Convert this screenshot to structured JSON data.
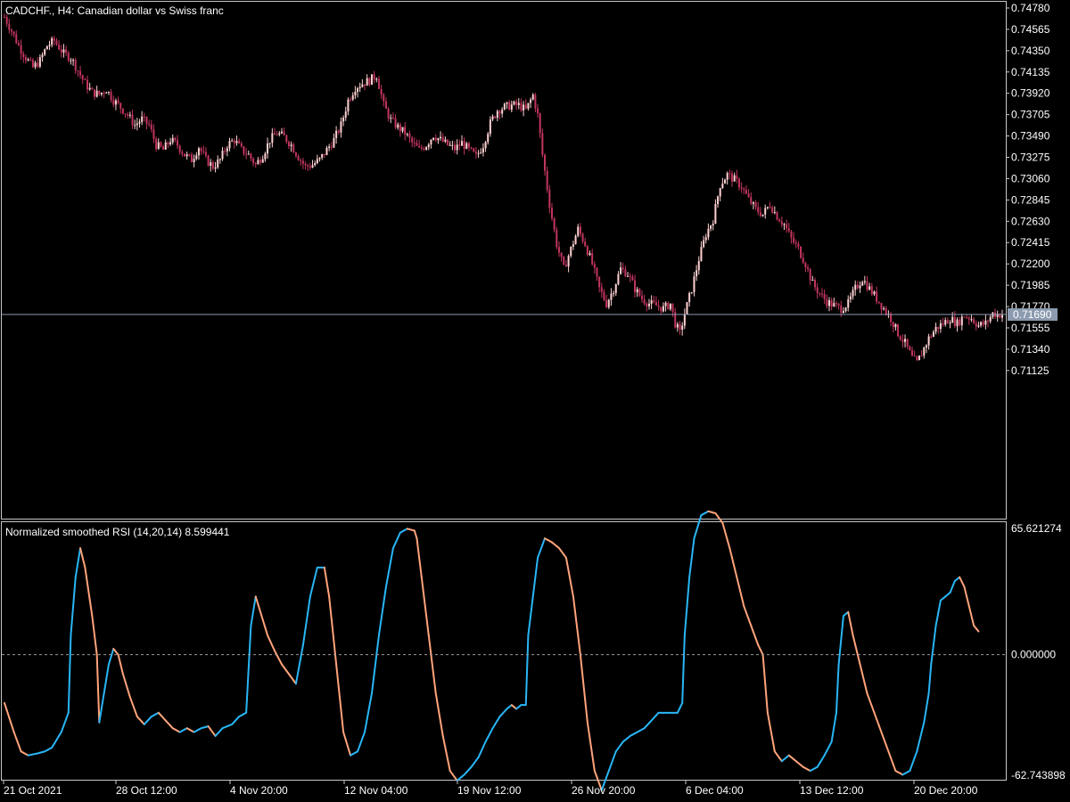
{
  "colors": {
    "background": "#000000",
    "frame": "#c8c8c8",
    "text": "#ffffff",
    "bull_candle": "#ffd1d1",
    "bear_candle": "#c2355e",
    "rsi_up": "#29b6f6",
    "rsi_down": "#ffa37a",
    "price_line": "#8c9bb0",
    "price_badge": "#8c9bb0"
  },
  "chart_data": {
    "type": "candlestick",
    "symbol_header": "CADCHF., H4:  Canadian dollar vs Swiss franc",
    "price_axis_ticks": [
      "0.74780",
      "0.74565",
      "0.74350",
      "0.74135",
      "0.73920",
      "0.73705",
      "0.73490",
      "0.73275",
      "0.73060",
      "0.72845",
      "0.72630",
      "0.72415",
      "0.72200",
      "0.71985",
      "0.71770",
      "0.71555",
      "0.71340",
      "0.71125"
    ],
    "price_range": [
      0.71,
      0.748
    ],
    "current_price": "0.71690",
    "time_axis_labels": [
      "21 Oct 2021",
      "28 Oct 12:00",
      "4 Nov 20:00",
      "12 Nov 04:00",
      "19 Nov 12:00",
      "26 Nov 20:00",
      "6 Dec 04:00",
      "13 Dec 12:00",
      "20 Dec 20:00"
    ],
    "price_anchors": [
      [
        0,
        0.7469
      ],
      [
        3,
        0.7455
      ],
      [
        6,
        0.744
      ],
      [
        9,
        0.7428
      ],
      [
        12,
        0.7418
      ],
      [
        15,
        0.7425
      ],
      [
        18,
        0.744
      ],
      [
        21,
        0.7445
      ],
      [
        25,
        0.7432
      ],
      [
        28,
        0.7428
      ],
      [
        31,
        0.7415
      ],
      [
        34,
        0.7402
      ],
      [
        37,
        0.7393
      ],
      [
        40,
        0.7391
      ],
      [
        43,
        0.7396
      ],
      [
        46,
        0.7385
      ],
      [
        49,
        0.7378
      ],
      [
        52,
        0.737
      ],
      [
        55,
        0.736
      ],
      [
        58,
        0.7366
      ],
      [
        61,
        0.736
      ],
      [
        64,
        0.734
      ],
      [
        67,
        0.7335
      ],
      [
        70,
        0.7345
      ],
      [
        73,
        0.734
      ],
      [
        76,
        0.733
      ],
      [
        79,
        0.7325
      ],
      [
        82,
        0.7338
      ],
      [
        85,
        0.7325
      ],
      [
        88,
        0.7318
      ],
      [
        91,
        0.7325
      ],
      [
        94,
        0.734
      ],
      [
        97,
        0.7345
      ],
      [
        100,
        0.7335
      ],
      [
        103,
        0.733
      ],
      [
        106,
        0.732
      ],
      [
        109,
        0.733
      ],
      [
        112,
        0.7345
      ],
      [
        115,
        0.7352
      ],
      [
        118,
        0.7348
      ],
      [
        121,
        0.734
      ],
      [
        124,
        0.7328
      ],
      [
        127,
        0.7318
      ],
      [
        130,
        0.732
      ],
      [
        133,
        0.7325
      ],
      [
        136,
        0.7335
      ],
      [
        139,
        0.7345
      ],
      [
        142,
        0.736
      ],
      [
        145,
        0.7385
      ],
      [
        148,
        0.7398
      ],
      [
        151,
        0.7402
      ],
      [
        154,
        0.7405
      ],
      [
        157,
        0.741
      ],
      [
        160,
        0.738
      ],
      [
        163,
        0.7365
      ],
      [
        166,
        0.7358
      ],
      [
        169,
        0.7352
      ],
      [
        172,
        0.7342
      ],
      [
        175,
        0.7335
      ],
      [
        178,
        0.734
      ],
      [
        181,
        0.735
      ],
      [
        184,
        0.7345
      ],
      [
        187,
        0.734
      ],
      [
        190,
        0.7336
      ],
      [
        193,
        0.7342
      ],
      [
        196,
        0.7335
      ],
      [
        199,
        0.7328
      ],
      [
        202,
        0.734
      ],
      [
        205,
        0.7362
      ],
      [
        208,
        0.7375
      ],
      [
        211,
        0.7378
      ],
      [
        214,
        0.738
      ],
      [
        217,
        0.738
      ],
      [
        220,
        0.7375
      ],
      [
        223,
        0.739
      ],
      [
        225,
        0.737
      ],
      [
        227,
        0.733
      ],
      [
        230,
        0.728
      ],
      [
        233,
        0.724
      ],
      [
        236,
        0.7215
      ],
      [
        239,
        0.7235
      ],
      [
        242,
        0.7255
      ],
      [
        245,
        0.724
      ],
      [
        248,
        0.722
      ],
      [
        251,
        0.7195
      ],
      [
        254,
        0.718
      ],
      [
        257,
        0.7195
      ],
      [
        260,
        0.7215
      ],
      [
        263,
        0.721
      ],
      [
        266,
        0.7195
      ],
      [
        269,
        0.7185
      ],
      [
        272,
        0.718
      ],
      [
        275,
        0.7178
      ],
      [
        278,
        0.7175
      ],
      [
        281,
        0.718
      ],
      [
        283,
        0.716
      ],
      [
        285,
        0.715
      ],
      [
        287,
        0.717
      ],
      [
        290,
        0.7195
      ],
      [
        293,
        0.7225
      ],
      [
        296,
        0.725
      ],
      [
        299,
        0.7265
      ],
      [
        302,
        0.73
      ],
      [
        305,
        0.731
      ],
      [
        308,
        0.7305
      ],
      [
        311,
        0.7298
      ],
      [
        314,
        0.7285
      ],
      [
        317,
        0.7275
      ],
      [
        320,
        0.727
      ],
      [
        323,
        0.728
      ],
      [
        326,
        0.7268
      ],
      [
        329,
        0.726
      ],
      [
        332,
        0.7245
      ],
      [
        335,
        0.7235
      ],
      [
        338,
        0.722
      ],
      [
        341,
        0.72
      ],
      [
        344,
        0.719
      ],
      [
        347,
        0.7182
      ],
      [
        350,
        0.7178
      ],
      [
        353,
        0.7175
      ],
      [
        356,
        0.718
      ],
      [
        359,
        0.7195
      ],
      [
        362,
        0.7205
      ],
      [
        365,
        0.7195
      ],
      [
        368,
        0.7185
      ],
      [
        371,
        0.7175
      ],
      [
        374,
        0.7165
      ],
      [
        377,
        0.715
      ],
      [
        380,
        0.714
      ],
      [
        383,
        0.7125
      ],
      [
        385,
        0.712
      ],
      [
        387,
        0.713
      ],
      [
        390,
        0.7145
      ],
      [
        393,
        0.7155
      ],
      [
        396,
        0.716
      ],
      [
        399,
        0.7165
      ],
      [
        402,
        0.716
      ],
      [
        405,
        0.7168
      ],
      [
        408,
        0.7165
      ],
      [
        411,
        0.7158
      ],
      [
        414,
        0.716
      ],
      [
        417,
        0.717
      ],
      [
        420,
        0.7169
      ]
    ],
    "indicator": {
      "title": "Normalized smoothed RSI (14,20,14) 8.599441",
      "axis_max_label": "65.621274",
      "axis_zero_label": "0.000000",
      "axis_min_label": "-62.743898",
      "range": [
        -62.743898,
        65.621274
      ],
      "anchors": [
        [
          0,
          -25
        ],
        [
          4,
          -40
        ],
        [
          7,
          -50
        ],
        [
          10,
          -52
        ],
        [
          14,
          -51
        ],
        [
          17,
          -50
        ],
        [
          20,
          -48
        ],
        [
          24,
          -40
        ],
        [
          27,
          -30
        ],
        [
          28,
          10
        ],
        [
          30,
          40
        ],
        [
          32,
          55
        ],
        [
          34,
          45
        ],
        [
          37,
          20
        ],
        [
          39,
          0
        ],
        [
          40,
          -35
        ],
        [
          42,
          -20
        ],
        [
          44,
          -5
        ],
        [
          46,
          3
        ],
        [
          48,
          0
        ],
        [
          50,
          -10
        ],
        [
          53,
          -22
        ],
        [
          56,
          -32
        ],
        [
          59,
          -36
        ],
        [
          62,
          -32
        ],
        [
          65,
          -30
        ],
        [
          68,
          -34
        ],
        [
          71,
          -38
        ],
        [
          74,
          -40
        ],
        [
          77,
          -38
        ],
        [
          80,
          -40
        ],
        [
          83,
          -38
        ],
        [
          86,
          -37
        ],
        [
          89,
          -42
        ],
        [
          92,
          -38
        ],
        [
          96,
          -36
        ],
        [
          99,
          -32
        ],
        [
          102,
          -30
        ],
        [
          104,
          15
        ],
        [
          106,
          30
        ],
        [
          108,
          22
        ],
        [
          111,
          10
        ],
        [
          114,
          2
        ],
        [
          117,
          -5
        ],
        [
          120,
          -10
        ],
        [
          123,
          -15
        ],
        [
          126,
          5
        ],
        [
          129,
          30
        ],
        [
          132,
          45
        ],
        [
          135,
          45
        ],
        [
          137,
          30
        ],
        [
          140,
          -5
        ],
        [
          143,
          -40
        ],
        [
          146,
          -52
        ],
        [
          149,
          -50
        ],
        [
          152,
          -40
        ],
        [
          155,
          -20
        ],
        [
          158,
          10
        ],
        [
          161,
          35
        ],
        [
          164,
          55
        ],
        [
          167,
          63
        ],
        [
          170,
          65
        ],
        [
          173,
          64
        ],
        [
          174,
          60
        ],
        [
          176,
          40
        ],
        [
          179,
          10
        ],
        [
          182,
          -20
        ],
        [
          185,
          -42
        ],
        [
          188,
          -60
        ],
        [
          191,
          -65
        ],
        [
          194,
          -62
        ],
        [
          197,
          -58
        ],
        [
          200,
          -53
        ],
        [
          203,
          -45
        ],
        [
          206,
          -38
        ],
        [
          209,
          -32
        ],
        [
          212,
          -28
        ],
        [
          214,
          -26
        ],
        [
          216,
          -28
        ],
        [
          218,
          -26
        ],
        [
          220,
          -26
        ],
        [
          221,
          10
        ],
        [
          223,
          30
        ],
        [
          225,
          50
        ],
        [
          228,
          60
        ],
        [
          231,
          58
        ],
        [
          234,
          55
        ],
        [
          237,
          50
        ],
        [
          240,
          30
        ],
        [
          243,
          0
        ],
        [
          246,
          -35
        ],
        [
          249,
          -60
        ],
        [
          252,
          -70
        ],
        [
          255,
          -60
        ],
        [
          258,
          -50
        ],
        [
          261,
          -45
        ],
        [
          264,
          -42
        ],
        [
          267,
          -40
        ],
        [
          270,
          -38
        ],
        [
          273,
          -34
        ],
        [
          276,
          -30
        ],
        [
          279,
          -30
        ],
        [
          282,
          -30
        ],
        [
          284,
          -30
        ],
        [
          286,
          -25
        ],
        [
          287,
          10
        ],
        [
          289,
          40
        ],
        [
          291,
          60
        ],
        [
          294,
          72
        ],
        [
          297,
          74
        ],
        [
          300,
          73
        ],
        [
          303,
          68
        ],
        [
          306,
          55
        ],
        [
          309,
          40
        ],
        [
          312,
          25
        ],
        [
          315,
          15
        ],
        [
          318,
          5
        ],
        [
          320,
          0
        ],
        [
          322,
          -30
        ],
        [
          325,
          -50
        ],
        [
          328,
          -55
        ],
        [
          331,
          -52
        ],
        [
          334,
          -55
        ],
        [
          337,
          -58
        ],
        [
          340,
          -60
        ],
        [
          343,
          -58
        ],
        [
          346,
          -52
        ],
        [
          349,
          -45
        ],
        [
          351,
          -30
        ],
        [
          352,
          -5
        ],
        [
          354,
          20
        ],
        [
          356,
          22
        ],
        [
          358,
          10
        ],
        [
          361,
          -5
        ],
        [
          364,
          -20
        ],
        [
          367,
          -30
        ],
        [
          370,
          -40
        ],
        [
          373,
          -50
        ],
        [
          376,
          -60
        ],
        [
          379,
          -62
        ],
        [
          382,
          -60
        ],
        [
          385,
          -50
        ],
        [
          388,
          -35
        ],
        [
          390,
          -20
        ],
        [
          391,
          -5
        ],
        [
          393,
          15
        ],
        [
          395,
          28
        ],
        [
          397,
          30
        ],
        [
          399,
          32
        ],
        [
          401,
          38
        ],
        [
          403,
          40
        ],
        [
          405,
          35
        ],
        [
          407,
          25
        ],
        [
          409,
          15
        ],
        [
          411,
          12
        ]
      ]
    }
  }
}
